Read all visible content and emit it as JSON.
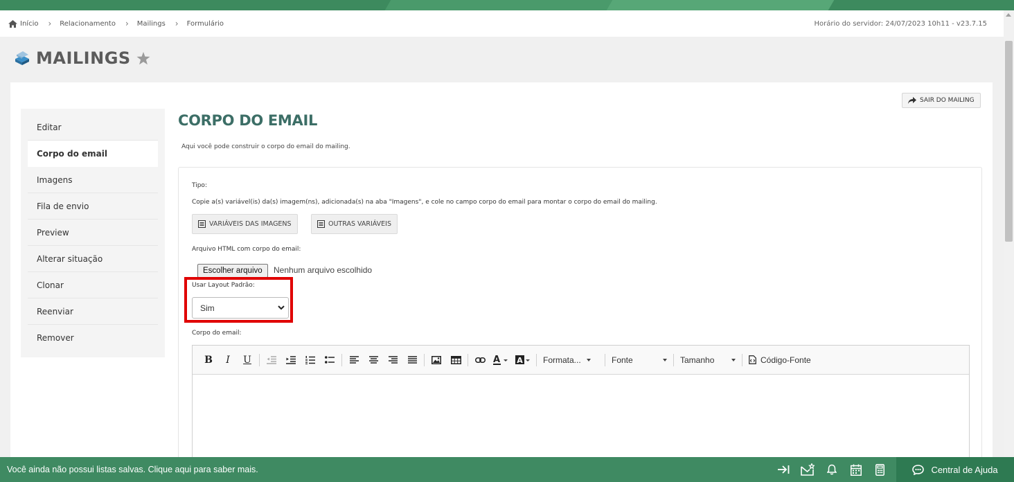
{
  "breadcrumb": {
    "items": [
      "Início",
      "Relacionamento",
      "Mailings",
      "Formulário"
    ],
    "server_time": "Horário do servidor: 24/07/2023 10h11 - v23.7.15"
  },
  "page": {
    "title": "MAILINGS"
  },
  "sidenav": {
    "items": [
      {
        "label": "Editar"
      },
      {
        "label": "Corpo do email",
        "active": true
      },
      {
        "label": "Imagens"
      },
      {
        "label": "Fila de envio"
      },
      {
        "label": "Preview"
      },
      {
        "label": "Alterar situação"
      },
      {
        "label": "Clonar"
      },
      {
        "label": "Reenviar"
      },
      {
        "label": "Remover"
      }
    ]
  },
  "content": {
    "exit_label": "SAIR DO MAILING",
    "title": "CORPO DO EMAIL",
    "description": "Aqui você pode construir o corpo do email do mailing.",
    "tipo_label": "Tipo:",
    "instructions": "Copie a(s) variável(is) da(s) imagem(ns), adicionada(s) na aba \"Imagens\", e cole no campo corpo do email para montar o corpo do email do mailing.",
    "btn_image_vars": "VARIÁVEIS DAS IMAGENS",
    "btn_other_vars": "OUTRAS VARIÁVEIS",
    "file_label": "Arquivo HTML com corpo do email:",
    "file_button": "Escolher arquivo",
    "file_status": "Nenhum arquivo escolhido",
    "layout_label": "Usar Layout Padrão:",
    "layout_value": "Sim",
    "body_label": "Corpo do email:"
  },
  "editor": {
    "format_label": "Formata...",
    "font_label": "Fonte",
    "size_label": "Tamanho",
    "source_label": "Código-Fonte"
  },
  "footer": {
    "message": "Você ainda não possui listas salvas. Clique aqui para saber mais.",
    "help_label": "Central de Ajuda"
  },
  "colors": {
    "brand_green": "#3f8a62",
    "title_teal": "#3c6e66",
    "highlight_red": "#e00000"
  }
}
